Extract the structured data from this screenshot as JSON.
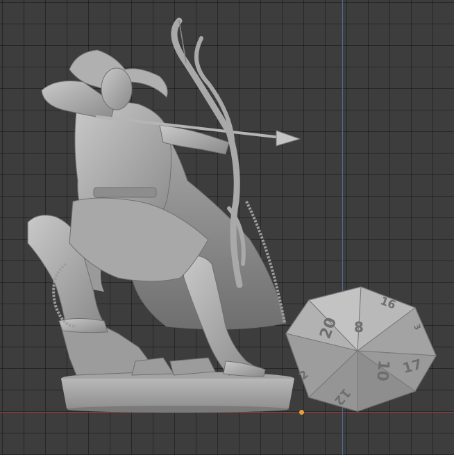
{
  "viewport": {
    "background": "#3d3d3d",
    "grid_color": "#2a2a2a",
    "z_axis_color": "#4d6f9a",
    "x_axis_color": "#9b3b3b",
    "origin_color": "#e8a13a"
  },
  "scene": {
    "model": "elf-archer-miniature-icon",
    "die": {
      "model": "d20-die-icon",
      "faces": [
        "20",
        "8",
        "16",
        "2",
        "10",
        "17",
        "12",
        "3"
      ]
    }
  }
}
